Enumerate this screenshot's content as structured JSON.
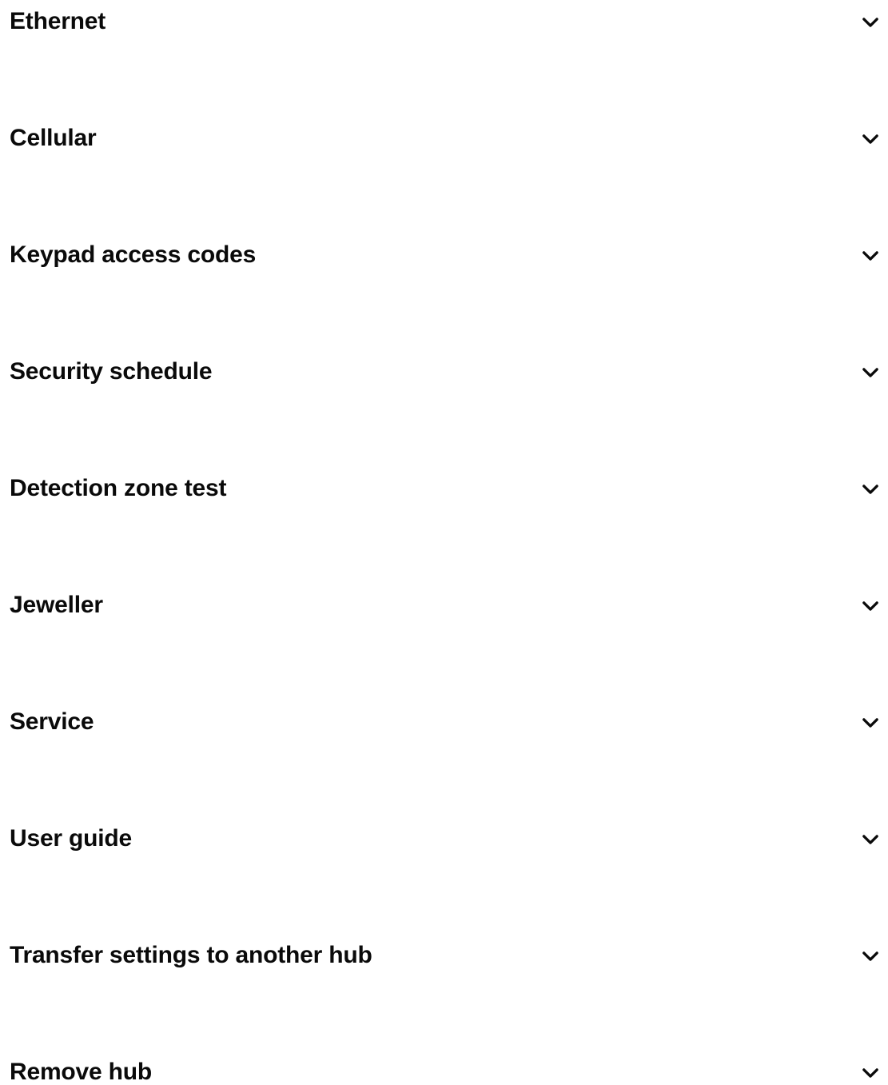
{
  "accordion": {
    "items": [
      {
        "label": "Ethernet",
        "icon": "chevron-down-icon"
      },
      {
        "label": "Cellular",
        "icon": "chevron-down-icon"
      },
      {
        "label": "Keypad access codes",
        "icon": "chevron-down-icon"
      },
      {
        "label": "Security schedule",
        "icon": "chevron-down-icon"
      },
      {
        "label": "Detection zone test",
        "icon": "chevron-down-icon"
      },
      {
        "label": "Jeweller",
        "icon": "chevron-down-icon"
      },
      {
        "label": "Service",
        "icon": "chevron-down-icon"
      },
      {
        "label": "User guide",
        "icon": "chevron-down-icon"
      },
      {
        "label": "Transfer settings to another hub",
        "icon": "chevron-down-icon"
      },
      {
        "label": "Remove hub",
        "icon": "chevron-down-icon"
      }
    ]
  },
  "colors": {
    "text": "#0a0a0a",
    "background": "#ffffff"
  }
}
